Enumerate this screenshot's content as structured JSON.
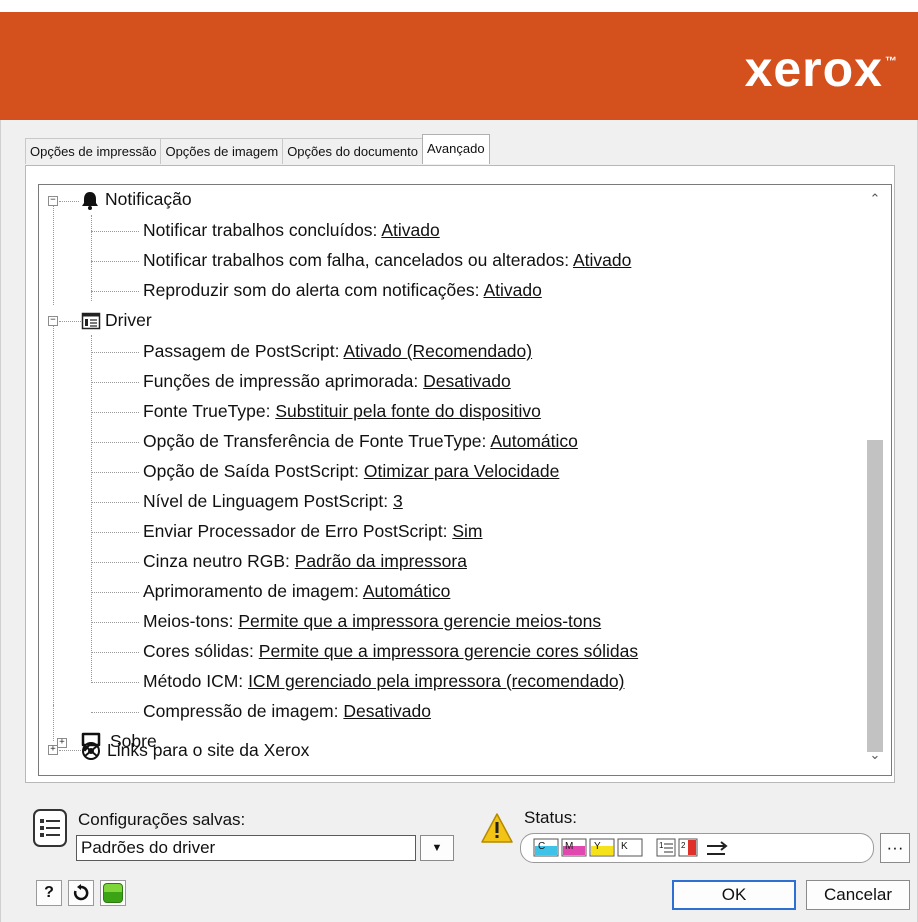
{
  "brand": {
    "name": "xerox",
    "tm": "™"
  },
  "tabs": [
    {
      "label": "Opções de impressão"
    },
    {
      "label": "Opções de imagem"
    },
    {
      "label": "Opções do documento"
    },
    {
      "label": "Avançado"
    }
  ],
  "tree": {
    "notificacao": {
      "label": "Notificação",
      "items": [
        {
          "label": "Notificar trabalhos concluídos:",
          "value": "Ativado"
        },
        {
          "label": "Notificar trabalhos com falha, cancelados ou alterados:",
          "value": "Ativado"
        },
        {
          "label": "Reproduzir som do alerta com notificações:",
          "value": "Ativado"
        }
      ]
    },
    "driver": {
      "label": "Driver",
      "items": [
        {
          "label": "Passagem de PostScript:",
          "value": "Ativado (Recomendado)"
        },
        {
          "label": "Funções de impressão aprimorada:",
          "value": "Desativado"
        },
        {
          "label": "Fonte TrueType:",
          "value": "Substituir pela fonte do dispositivo"
        },
        {
          "label": "Opção de Transferência de Fonte TrueType:",
          "value": "Automático"
        },
        {
          "label": "Opção de Saída PostScript:",
          "value": "Otimizar para Velocidade"
        },
        {
          "label": "Nível de Linguagem PostScript:",
          "value": "3"
        },
        {
          "label": "Enviar Processador de Erro PostScript:",
          "value": "Sim"
        },
        {
          "label": "Cinza neutro RGB:",
          "value": "Padrão da impressora"
        },
        {
          "label": "Aprimoramento de imagem:",
          "value": "Automático"
        },
        {
          "label": "Meios-tons:",
          "value": "Permite que a impressora gerencie meios-tons"
        },
        {
          "label": "Cores sólidas:",
          "value": "Permite que a impressora gerencie cores sólidas"
        },
        {
          "label": "Método ICM:",
          "value": "ICM gerenciado pela impressora (recomendado)"
        },
        {
          "label": "Compressão de imagem:",
          "value": "Desativado"
        }
      ]
    },
    "links": {
      "label": "Links para o site da Xerox"
    },
    "sobre": {
      "label": "Sobre"
    }
  },
  "saved": {
    "label": "Configurações salvas:",
    "value": "Padrões do driver"
  },
  "status": {
    "label": "Status:",
    "toners": [
      "C",
      "M",
      "Y",
      "K"
    ],
    "tray_numbers": [
      "1",
      "2"
    ]
  },
  "buttons": {
    "help": "?",
    "more": "···",
    "ok": "OK",
    "cancel": "Cancelar"
  },
  "colors": {
    "banner": "#d4501c",
    "cyan": "#3fc2e8",
    "magenta": "#e048b0",
    "yellow": "#f5e21a",
    "warning": "#f3c316",
    "ok_border": "#2d6fd2"
  }
}
